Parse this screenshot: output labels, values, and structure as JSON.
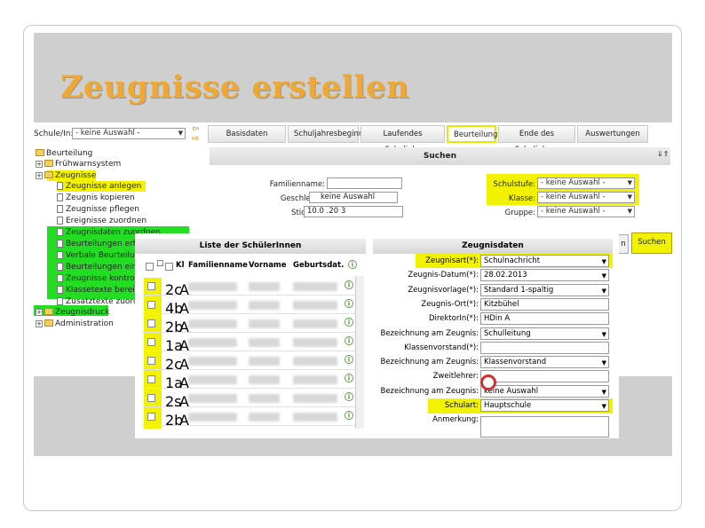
{
  "slide": {
    "title": "Zeugnisse erstellen"
  },
  "topbar": {
    "school_label": "Schule/In:",
    "school_value": "- keine Auswahl -"
  },
  "tabs": [
    "Basisdaten",
    "Schuljahresbeginn",
    "Laufendes Schuljahr",
    "Beurteilung",
    "Ende des Schuljahres",
    "Auswertungen"
  ],
  "tree": {
    "root": "Beurteilung",
    "items": [
      "Frühwarnsystem",
      "Zeugnisse",
      "Zeugnisse anlegen",
      "Zeugnis kopieren",
      "Zeugnisse pflegen",
      "Ereignisse zuordnen",
      "Zeugnisdaten zuordnen",
      "Beurteilungen erfa",
      "Verbale Beurteilung",
      "Beurteilungen eintr",
      "Zeugnisse kontrolle",
      "Klassetexte bereit",
      "Zusatztexte zuord",
      "Zeugnisdruck",
      "Administration"
    ]
  },
  "search": {
    "title": "Suchen",
    "familienname_label": "Familienname:",
    "geschlecht_label": "Geschlecht:",
    "geschlecht_value": "keine Auswahl",
    "stichtag_label": "Stichtag:",
    "stichtag_value": "10.0 .20 3",
    "schulstufe_label": "Schulstufe:",
    "schulstufe_value": "- keine Auswahl -",
    "klasse_label": "Klasse:",
    "klasse_value": "- keine Auswahl -",
    "gruppe_label": "Gruppe:",
    "gruppe_value": "- keine Auswahl -",
    "reset_label": "n",
    "search_button": "Suchen"
  },
  "students": {
    "title": "Liste der SchülerInnen",
    "columns": [
      "Kl",
      "Familienname",
      "Vorname",
      "Geburtsdat."
    ],
    "rows": [
      {
        "kl": "2c",
        "fam": "A"
      },
      {
        "kl": "4b",
        "fam": "A"
      },
      {
        "kl": "2b",
        "fam": "A"
      },
      {
        "kl": "1a",
        "fam": "A"
      },
      {
        "kl": "2c",
        "fam": "A"
      },
      {
        "kl": "1a",
        "fam": "A"
      },
      {
        "kl": "2s",
        "fam": "A"
      },
      {
        "kl": "2b",
        "fam": "A"
      }
    ]
  },
  "zeugnis": {
    "title": "Zeugnisdaten",
    "fields": [
      {
        "label": "Zeugnisart(*):",
        "value": "Schulnachricht",
        "dropdown": true
      },
      {
        "label": "Zeugnis-Datum(*):",
        "value": "28.02.2013",
        "dropdown": true
      },
      {
        "label": "Zeugnisvorlage(*):",
        "value": "Standard 1-spaltig",
        "dropdown": true
      },
      {
        "label": "Zeugnis-Ort(*):",
        "value": "Kitzbühel",
        "dropdown": false
      },
      {
        "label": "DirektorIn(*):",
        "value": "HDin A",
        "dropdown": false
      },
      {
        "label": "Bezeichnung am Zeugnis:",
        "value": "Schulleitung",
        "dropdown": true
      },
      {
        "label": "Klassenvorstand(*):",
        "value": "",
        "dropdown": false
      },
      {
        "label": "Bezeichnung am Zeugnis:",
        "value": "Klassenvorstand",
        "dropdown": true
      },
      {
        "label": "Zweitlehrer:",
        "value": "",
        "dropdown": false
      },
      {
        "label": "Bezeichnung am Zeugnis:",
        "value": "keine Auswahl",
        "dropdown": true
      },
      {
        "label": "Schulart:",
        "value": "Hauptschule",
        "dropdown": true
      },
      {
        "label": "Anmerkung:",
        "value": "",
        "dropdown": false
      }
    ]
  }
}
